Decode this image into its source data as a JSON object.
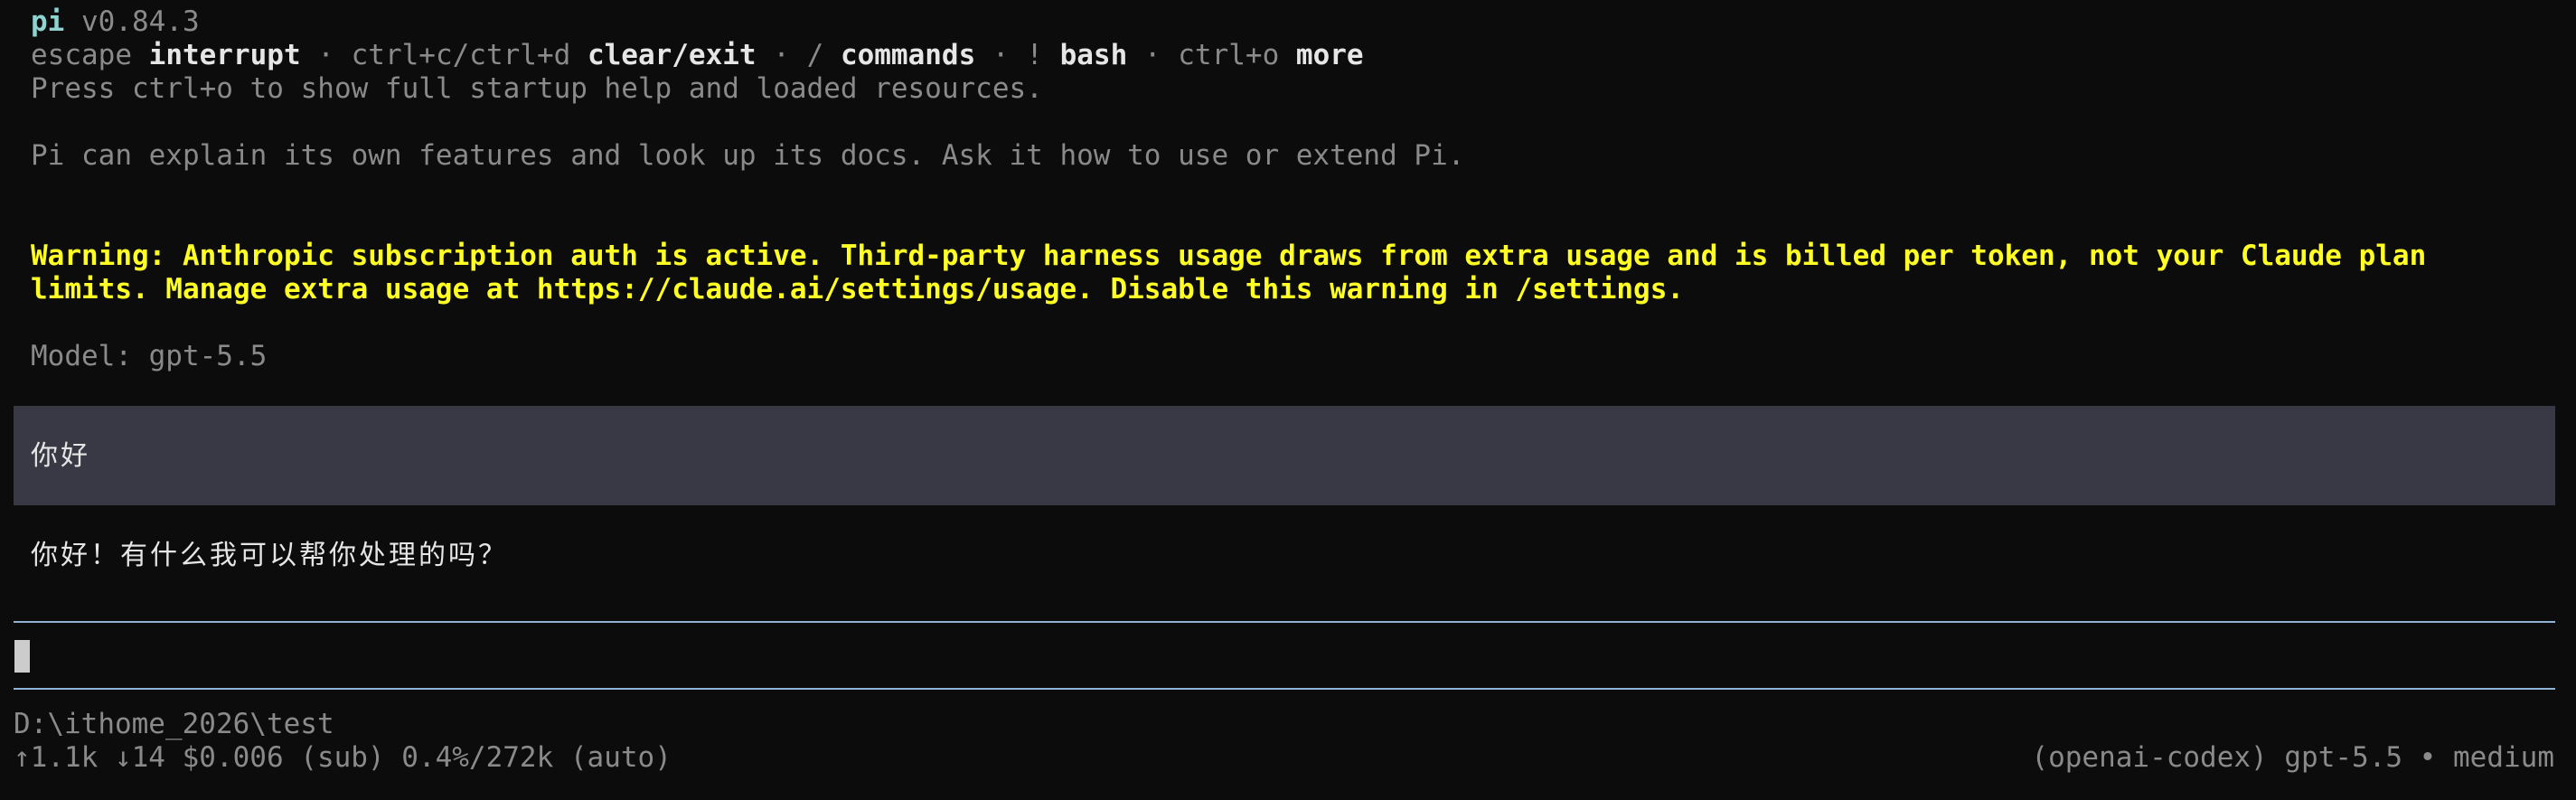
{
  "header": {
    "app_name": "pi",
    "version": "v0.84.3"
  },
  "shortcuts": [
    {
      "key": "escape",
      "action": "interrupt",
      "sep": " · "
    },
    {
      "key": "ctrl+c/ctrl+d",
      "action": "clear/exit",
      "sep": " · "
    },
    {
      "key": "/",
      "action": "commands",
      "sep": " · "
    },
    {
      "key": "!",
      "action": "bash",
      "sep": " · "
    },
    {
      "key": "ctrl+o",
      "action": "more",
      "sep": ""
    }
  ],
  "startup_hint": "Press ctrl+o to show full startup help and loaded resources.",
  "intro": "Pi can explain its own features and look up its docs. Ask it how to use or extend Pi.",
  "warning": {
    "line1": "Warning: Anthropic subscription auth is active. Third-party harness usage draws from extra usage and is billed per token, not your Claude plan",
    "line2": "limits. Manage extra usage at https://claude.ai/settings/usage. Disable this warning in /settings."
  },
  "model_line": "Model: gpt-5.5",
  "conversation": {
    "user_message": "你好",
    "assistant_message": "你好！有什么我可以帮你处理的吗？"
  },
  "input": {
    "value": ""
  },
  "footer": {
    "cwd": "D:\\ithome_2026\\test",
    "stats": "↑1.1k ↓14 $0.006 (sub) 0.4%/272k (auto)",
    "model_info": "(openai-codex) gpt-5.5 • medium"
  },
  "colors": {
    "background": "#0c0c0c",
    "warning": "#ffff24",
    "user_block": "#393945",
    "rule": "#8fb2d6"
  }
}
